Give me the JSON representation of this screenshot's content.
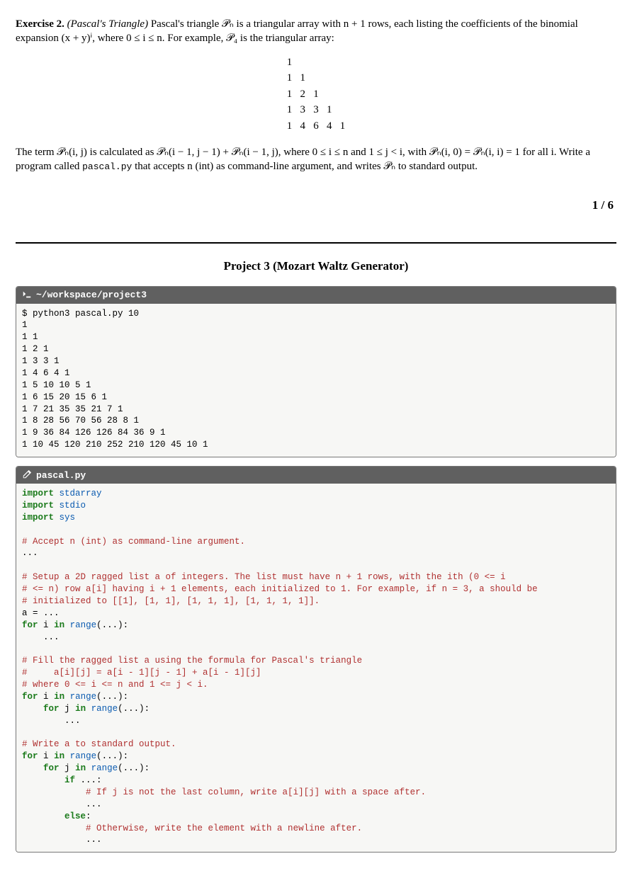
{
  "exercise": {
    "label": "Exercise 2.",
    "title_italic": "(Pascal's Triangle)",
    "intro_part": "Pascal's triangle 𝒫ₙ is a triangular array with n + 1 rows, each listing the coefficients of the binomial expansion (x + y)ⁱ, where 0 ≤ i ≤ n. For example, 𝒫₄ is the triangular array:",
    "triangle": "1\n1   1\n1   2   1\n1   3   3   1\n1   4   6   4   1",
    "term_desc_a": "The term 𝒫ₙ(i, j) is calculated as 𝒫ₙ(i − 1, j − 1) + 𝒫ₙ(i − 1, j), where 0 ≤ i ≤ n and 1 ≤ j < i, with 𝒫ₙ(i, 0) = 𝒫ₙ(i, i) = 1 for all i. Write a program called ",
    "code_filename": "pascal.py",
    "term_desc_b": " that accepts n (int) as command-line argument, and writes 𝒫ₙ to standard output."
  },
  "page_number": "1 / 6",
  "project_title": "Project 3 (Mozart Waltz Generator)",
  "terminal": {
    "prompt_icon": ">_",
    "path": "~/workspace/project3",
    "lines": "$ python3 pascal.py 10\n1\n1 1\n1 2 1\n1 3 3 1\n1 4 6 4 1\n1 5 10 10 5 1\n1 6 15 20 15 6 1\n1 7 21 35 35 21 7 1\n1 8 28 56 70 56 28 8 1\n1 9 36 84 126 126 84 36 9 1\n1 10 45 120 210 252 210 120 45 10 1"
  },
  "editor": {
    "filename": "pascal.py",
    "imp": "import",
    "mod1": "stdarray",
    "mod2": "stdio",
    "mod3": "sys",
    "c_accept": "# Accept n (int) as command-line argument.",
    "ellipsis": "...",
    "c_setup1": "# Setup a 2D ragged list a of integers. The list must have n + 1 rows, with the ith (0 <= i",
    "c_setup2": "# <= n) row a[i] having i + 1 elements, each initialized to 1. For example, if n = 3, a should be",
    "c_setup3": "# initialized to [[1], [1, 1], [1, 1, 1], [1, 1, 1, 1]].",
    "a_eq": "a = ...",
    "for_kw": "for",
    "in_kw": "in",
    "range_kw": "range",
    "loop_i": "i",
    "loop_j": "j",
    "loop_tail": "(...):",
    "c_fill1": "# Fill the ragged list a using the formula for Pascal's triangle",
    "c_fill2": "#     a[i][j] = a[i - 1][j - 1] + a[i - 1][j]",
    "c_fill3": "# where 0 <= i <= n and 1 <= j < i.",
    "c_write": "# Write a to standard output.",
    "if_kw": "if",
    "if_tail": "...:",
    "c_ifcomment": "# If j is not the last column, write a[i][j] with a space after.",
    "else_kw": "else",
    "colon": ":",
    "c_elsecomment": "# Otherwise, write the element with a newline after."
  }
}
